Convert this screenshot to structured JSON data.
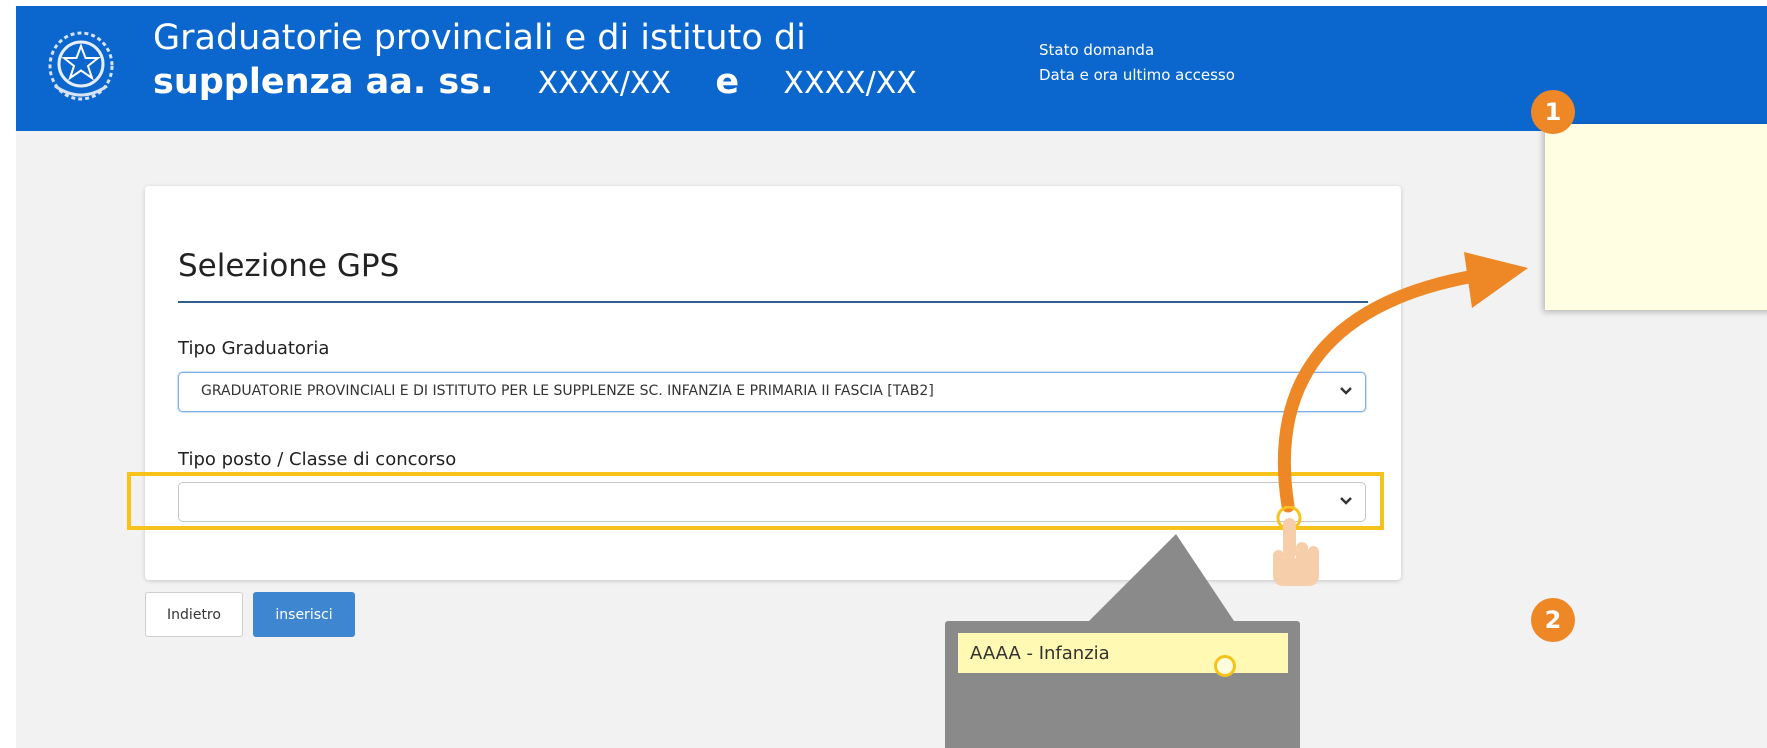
{
  "header": {
    "title_line1": "Graduatorie provinciali e di istituto di",
    "title_line2_word1": "supplenza aa. ss.",
    "title_line2_year1": "XXXX/XX",
    "title_line2_conj": "e",
    "title_line2_year2": "XXXX/XX",
    "status_label": "Stato domanda",
    "last_access_label": "Data e ora ultimo accesso"
  },
  "form": {
    "title": "Selezione GPS",
    "tipo_graduatoria": {
      "label": "Tipo Graduatoria",
      "value": "GRADUATORIE PROVINCIALI E DI ISTITUTO PER LE SUPPLENZE SC. INFANZIA E PRIMARIA II FASCIA [TAB2]"
    },
    "tipo_posto": {
      "label": "Tipo posto / Classe di concorso",
      "value": ""
    }
  },
  "buttons": {
    "back_label": "Indietro",
    "insert_label": "inserisci"
  },
  "callout": {
    "option_label": "AAAA - Infanzia"
  },
  "badges": {
    "step1": "1",
    "step2": "2"
  },
  "colors": {
    "header_blue": "#0b66cd",
    "highlight_yellow": "#f7c21a",
    "badge_orange": "#ee8725",
    "primary_button": "#3f86d0"
  },
  "icons": [
    "republic-emblem-icon",
    "chevron-down-icon",
    "pointing-hand-icon",
    "curved-arrow-icon"
  ]
}
